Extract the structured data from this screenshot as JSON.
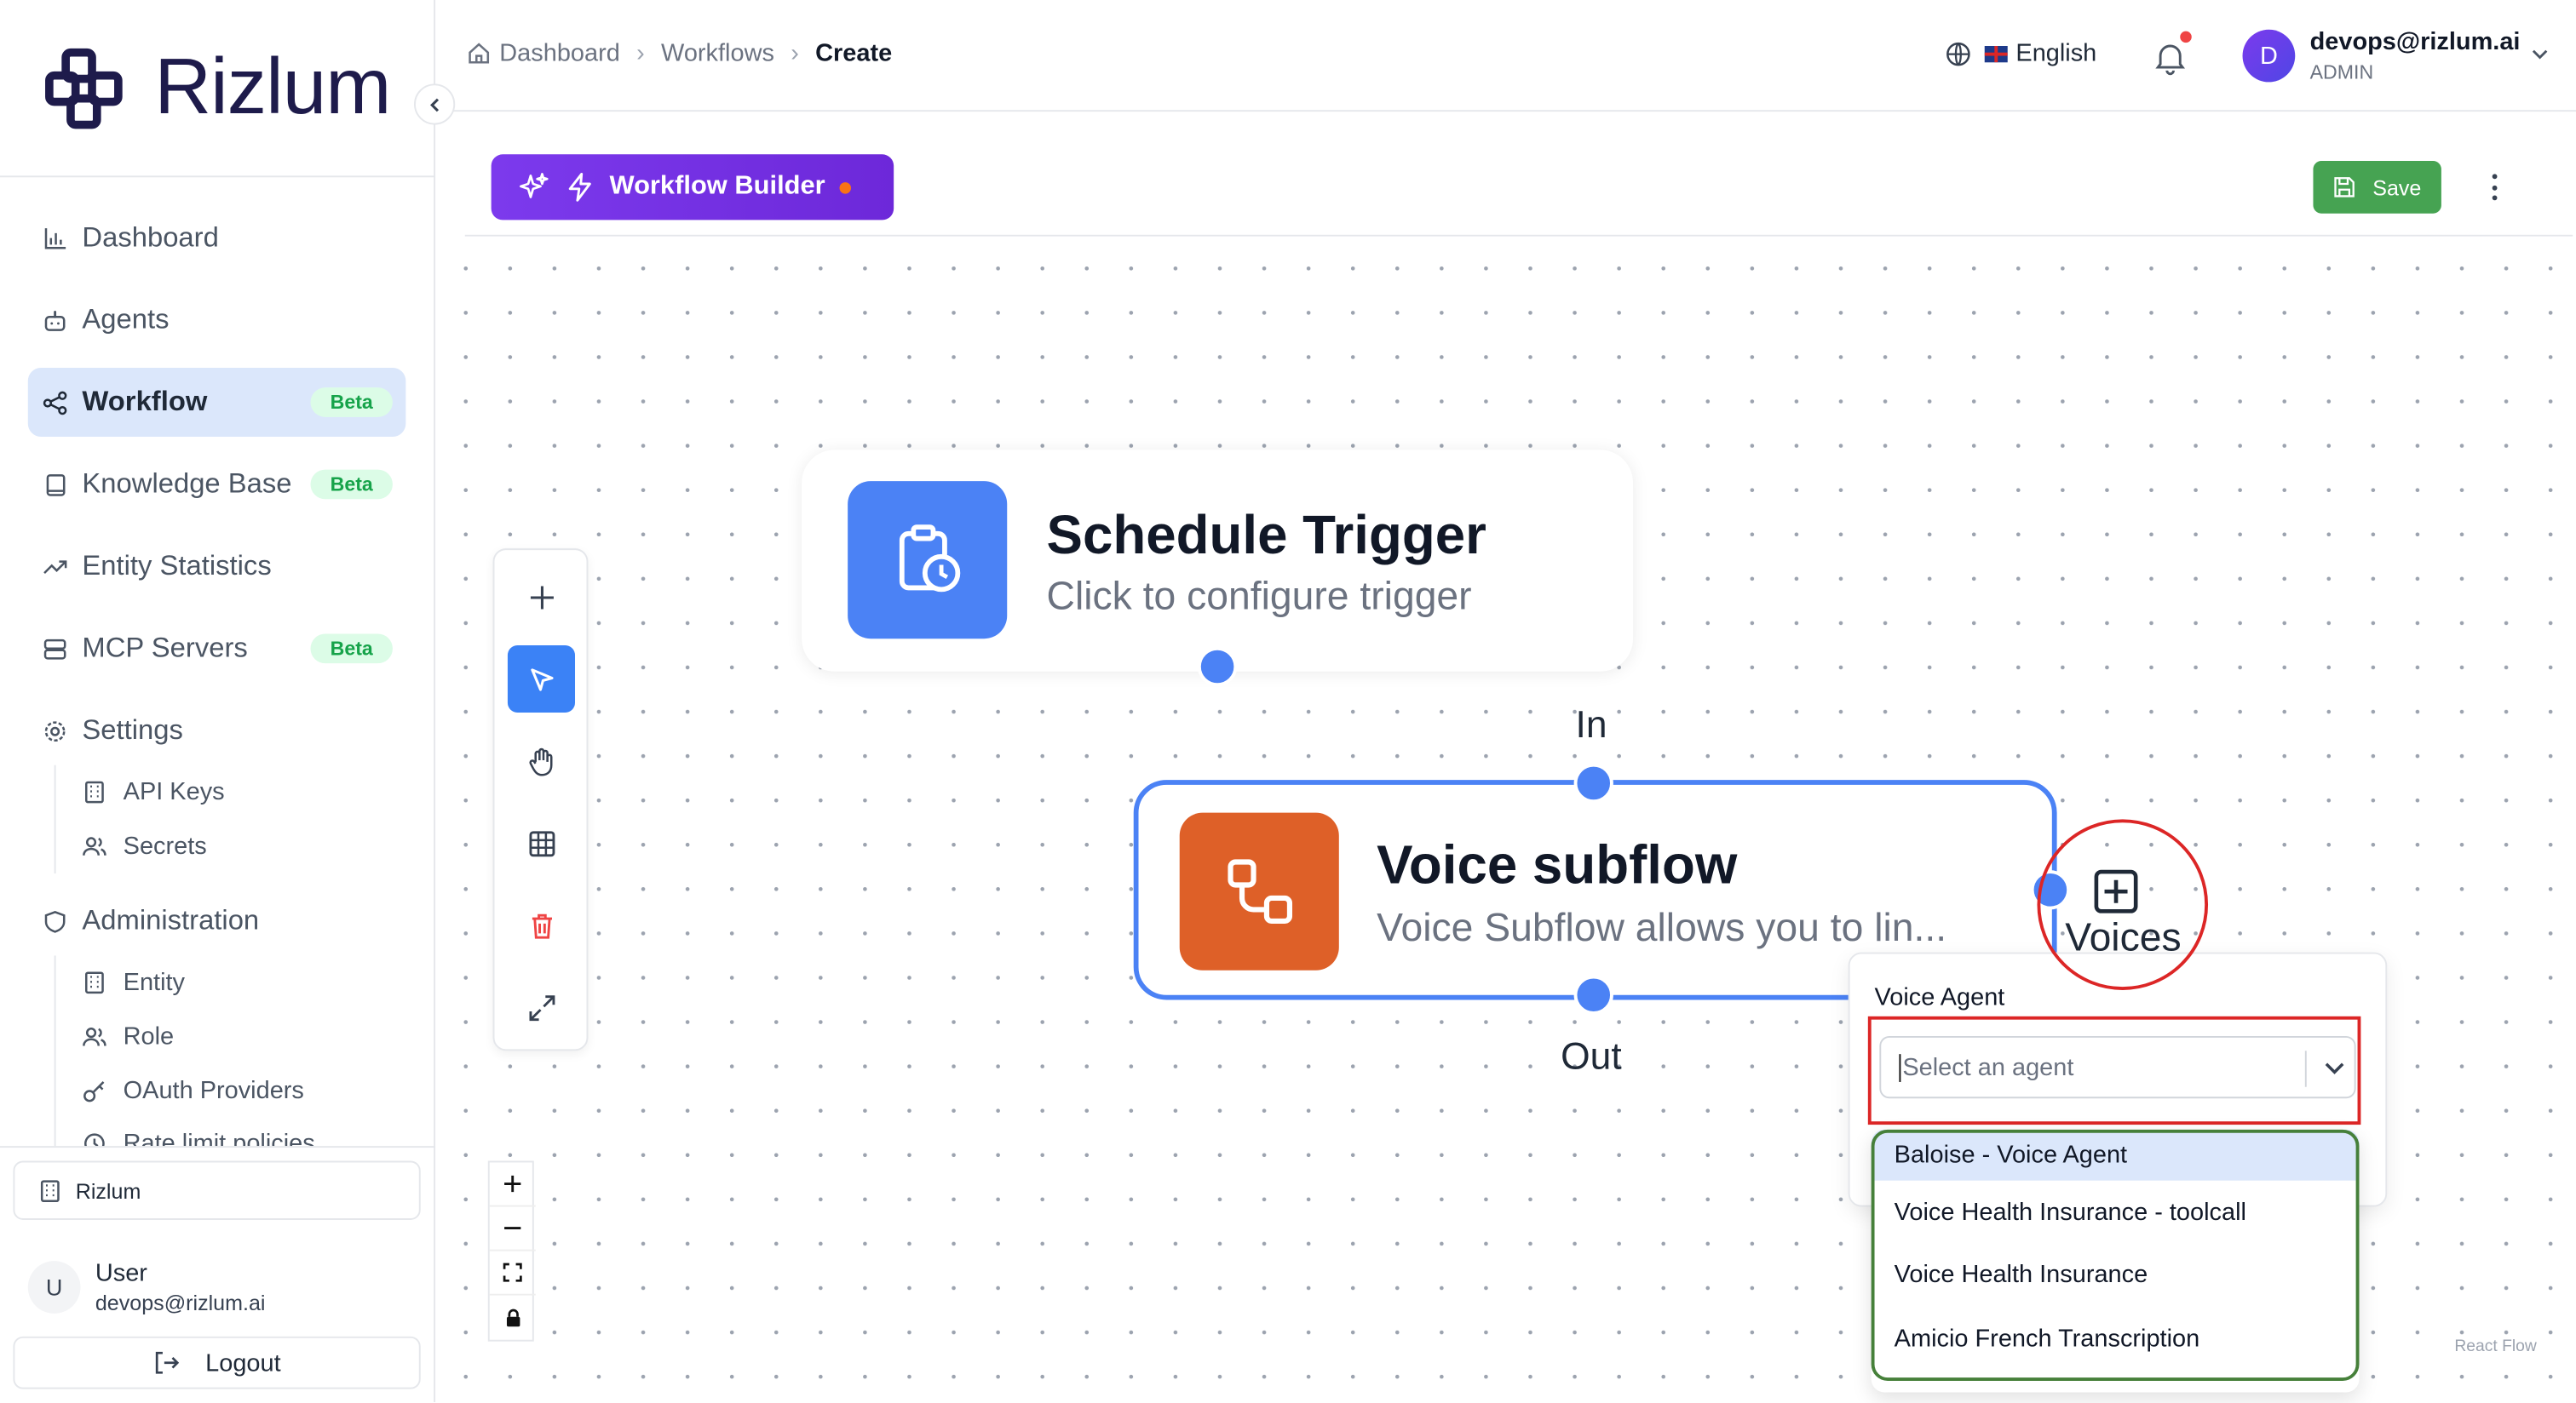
{
  "brand": {
    "name": "Rizlum"
  },
  "sidebar": {
    "items": [
      {
        "label": "Dashboard",
        "icon": "bar-chart-icon"
      },
      {
        "label": "Agents",
        "icon": "bot-icon"
      },
      {
        "label": "Workflow",
        "icon": "share-icon",
        "badge": "Beta"
      },
      {
        "label": "Knowledge Base",
        "icon": "book-icon",
        "badge": "Beta"
      },
      {
        "label": "Entity Statistics",
        "icon": "trending-up-icon"
      },
      {
        "label": "MCP Servers",
        "icon": "server-icon",
        "badge": "Beta"
      },
      {
        "label": "Settings",
        "icon": "gear-icon"
      }
    ],
    "settings_sub": [
      {
        "label": "API Keys",
        "icon": "building-icon"
      },
      {
        "label": "Secrets",
        "icon": "users-icon"
      }
    ],
    "administration": {
      "label": "Administration",
      "icon": "shield-icon"
    },
    "admin_sub": [
      {
        "label": "Entity",
        "icon": "building-icon"
      },
      {
        "label": "Role",
        "icon": "users-icon"
      },
      {
        "label": "OAuth Providers",
        "icon": "key-icon"
      },
      {
        "label": "Rate limit policies",
        "icon": "clock-icon"
      }
    ],
    "organization": "Rizlum",
    "user": {
      "initial": "U",
      "name": "User",
      "email": "devops@rizlum.ai"
    },
    "logout_label": "Logout"
  },
  "header": {
    "breadcrumb": [
      "Dashboard",
      "Workflows",
      "Create"
    ],
    "language": "English",
    "user": {
      "initial": "D",
      "email": "devops@rizlum.ai",
      "role": "ADMIN"
    }
  },
  "builder": {
    "title": "Workflow Builder",
    "save_label": "Save"
  },
  "canvas": {
    "nodes": [
      {
        "title": "Schedule Trigger",
        "subtitle": "Click to configure trigger",
        "color": "#4b82f5",
        "icon": "clipboard-clock-icon"
      },
      {
        "title": "Voice subflow",
        "subtitle": "Voice Subflow allows you to lin...",
        "color": "#de6028",
        "icon": "subflow-icon"
      }
    ],
    "handle_labels": {
      "in": "In",
      "out": "Out",
      "voices": "Voices"
    },
    "attribution": "React Flow"
  },
  "voice_agent_panel": {
    "label": "Voice Agent",
    "placeholder": "Select an agent",
    "options": [
      "Baloise - Voice Agent",
      "Voice Health Insurance - toolcall",
      "Voice Health Insurance",
      "Amicio French Transcription"
    ]
  },
  "colors": {
    "accent": "#3b82f6",
    "builder_purple": "#7c3aed",
    "save_green": "#46a352",
    "beta_green": "#16a34a",
    "highlight_red": "#dc2626",
    "highlight_green": "#46803a"
  }
}
